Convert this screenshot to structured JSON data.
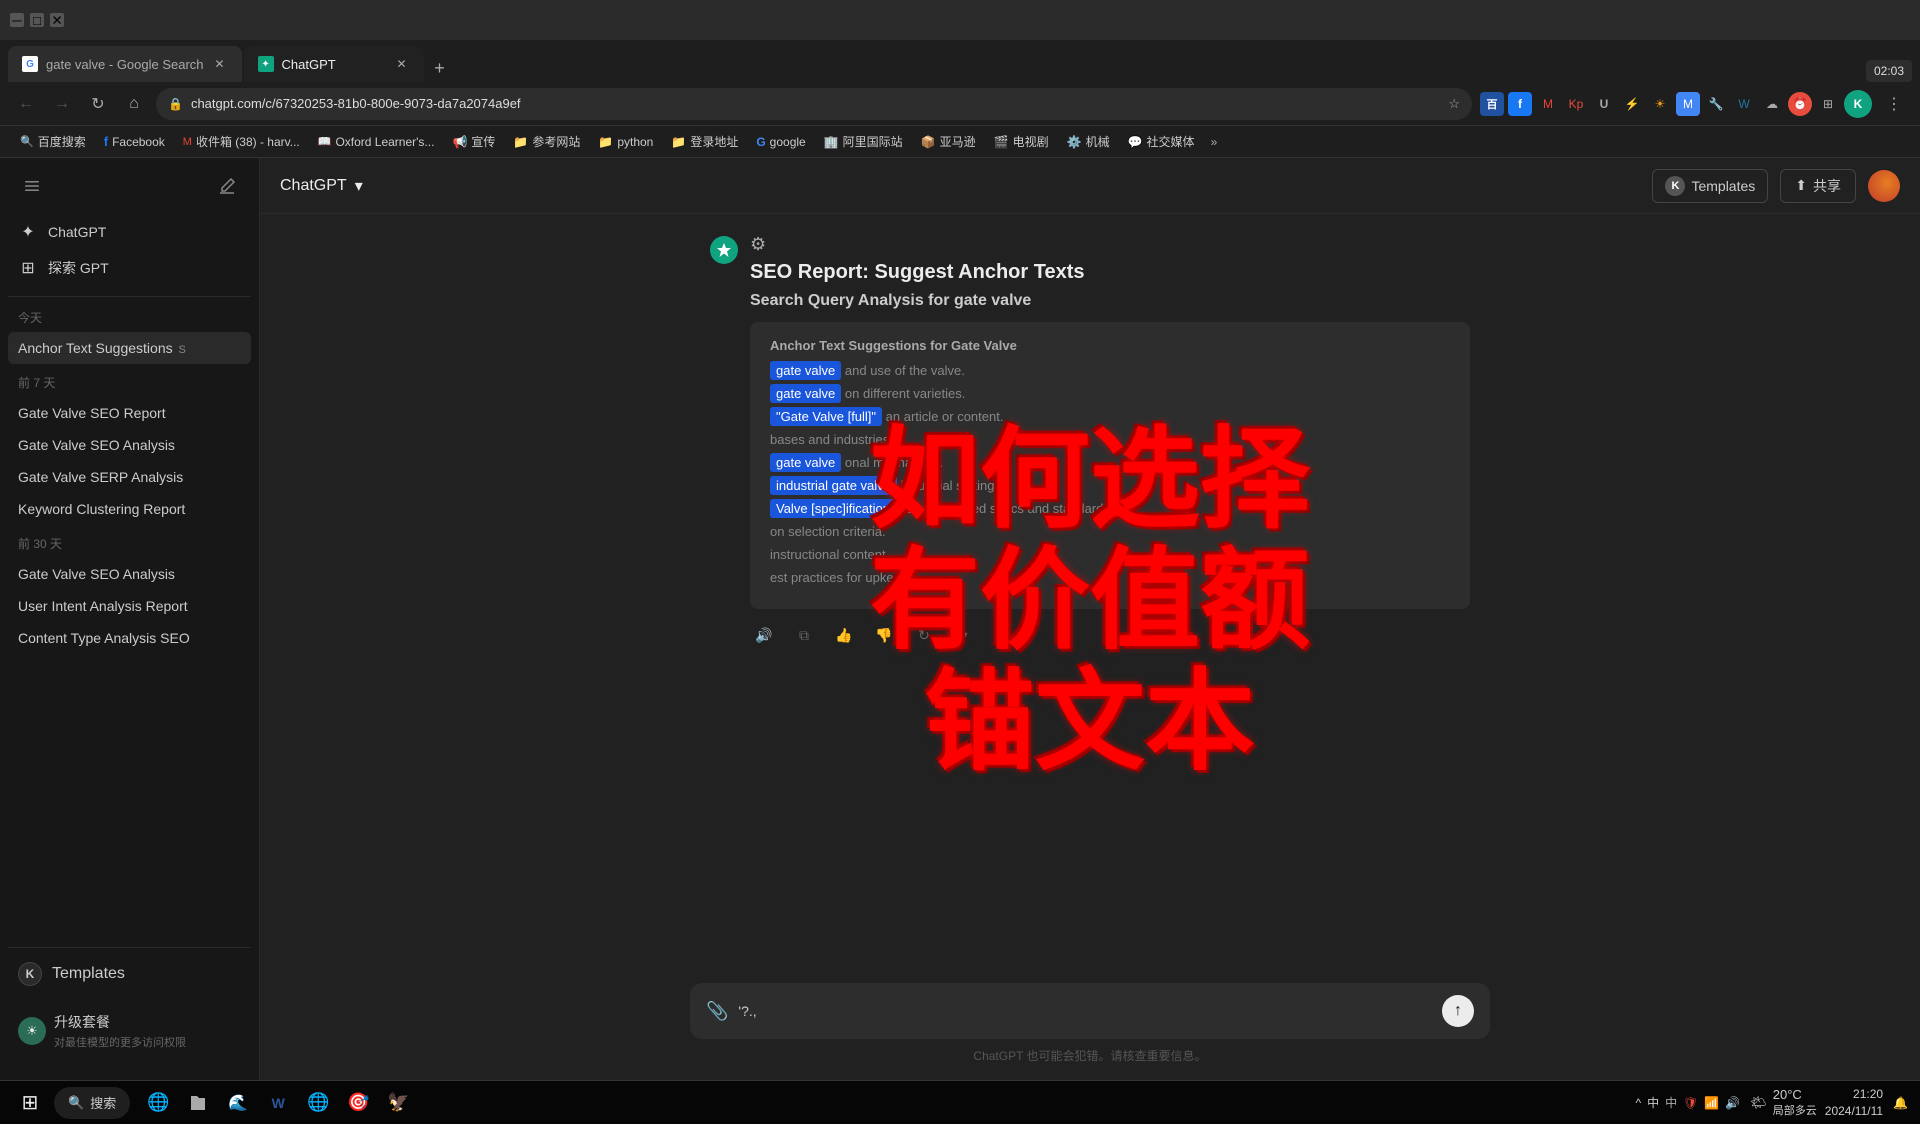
{
  "browser": {
    "tabs": [
      {
        "id": "tab1",
        "title": "gate valve - Google Search",
        "favicon": "G",
        "favicon_bg": "#fff",
        "favicon_color": "#4285f4",
        "active": false
      },
      {
        "id": "tab2",
        "title": "ChatGPT",
        "favicon": "✦",
        "favicon_bg": "#10a37f",
        "favicon_color": "#fff",
        "active": true
      }
    ],
    "new_tab_label": "+",
    "address_url": "chatgpt.com/c/67320253-81b0-800e-9073-da7a2074a9ef",
    "bookmarks": [
      {
        "label": "百度搜索",
        "icon": "🔍"
      },
      {
        "label": "Facebook",
        "icon": "f"
      },
      {
        "label": "收件箱 (38) - harv...",
        "icon": "M"
      },
      {
        "label": "Oxford Learner's...",
        "icon": "📖"
      },
      {
        "label": "宣传",
        "icon": "📢"
      },
      {
        "label": "参考网站",
        "icon": "📁"
      },
      {
        "label": "python",
        "icon": "📁"
      },
      {
        "label": "登录地址",
        "icon": "📁"
      },
      {
        "label": "google",
        "icon": "G"
      },
      {
        "label": "阿里国际站",
        "icon": "🏢"
      },
      {
        "label": "亚马逊",
        "icon": "📦"
      },
      {
        "label": "电视剧",
        "icon": "🎬"
      },
      {
        "label": "机械",
        "icon": "⚙️"
      },
      {
        "label": "社交媒体",
        "icon": "💬"
      }
    ],
    "bookmarks_more": "»",
    "time_badge": "02:03"
  },
  "sidebar": {
    "chatgpt_label": "ChatGPT",
    "explore_gpt_label": "探索 GPT",
    "today_label": "今天",
    "last7_label": "前 7 天",
    "last30_label": "前 30 天",
    "items_today": [
      {
        "id": "anchor-text",
        "label": "Anchor Text Suggestions",
        "badge": "S",
        "has_more": true
      }
    ],
    "items_7days": [
      {
        "id": "gv-seo-report",
        "label": "Gate Valve SEO Report"
      },
      {
        "id": "gv-seo-analysis",
        "label": "Gate Valve SEO Analysis"
      },
      {
        "id": "gv-serp-analysis",
        "label": "Gate Valve SERP Analysis"
      },
      {
        "id": "kw-clustering",
        "label": "Keyword Clustering Report"
      }
    ],
    "items_30days": [
      {
        "id": "gv-seo-analysis2",
        "label": "Gate Valve SEO Analysis"
      },
      {
        "id": "user-intent",
        "label": "User Intent Analysis Report"
      },
      {
        "id": "content-type",
        "label": "Content Type Analysis SEO"
      }
    ],
    "templates_label": "Templates",
    "upgrade_title": "升级套餐",
    "upgrade_subtitle": "对最佳模型的更多访问权限"
  },
  "header": {
    "chatgpt_title": "ChatGPT",
    "dropdown_symbol": "▾",
    "templates_label": "Templates",
    "share_label": "共享",
    "k_icon": "K"
  },
  "chat": {
    "title": "SEO Report: Suggest Anchor Texts",
    "subtitle": "Search Query Analysis for gate valve",
    "gear_icon": "⚙",
    "report_box": {
      "section_title": "Anchor Text Suggestions for Gate Valve",
      "items": [
        {
          "highlight": "gate valve",
          "desc": "and use of the valve."
        },
        {
          "highlight": "gate valve",
          "desc": "on different varieties."
        },
        {
          "highlight": "\"Gate Valve [full]\"",
          "desc": "an article or content."
        },
        {
          "highlight": "",
          "desc": "bases and industries."
        },
        {
          "highlight": "gate valve",
          "desc": "onal mechanism."
        },
        {
          "highlight": "industrial gate valve",
          "desc": "industrial settings."
        },
        {
          "highlight": "Valve [spec]ifications",
          "desc": "cts to detailed specs and standards."
        },
        {
          "highlight": "",
          "desc": "on selection criteria."
        },
        {
          "highlight": "",
          "desc": "instructional content."
        },
        {
          "highlight": "",
          "desc": "est practices for upkeep."
        }
      ]
    },
    "actions": {
      "audio": "🔊",
      "copy": "⧉",
      "thumbup": "👍",
      "thumbdown": "👎",
      "refresh": "↻",
      "expand": "▾"
    }
  },
  "input": {
    "placeholder": "'?.,",
    "attach_icon": "📎",
    "submit_icon": "↑",
    "disclaimer": "ChatGPT 也可能会犯错。请核查重要信息。"
  },
  "watermark": {
    "line1": "如何选择",
    "line2": "有价值额",
    "line3": "锚文本"
  },
  "taskbar": {
    "start_icon": "⊞",
    "search_placeholder": "搜索",
    "search_icon": "🔍",
    "time": "21:20",
    "date": "2024/11/11",
    "weather_icon": "🌤",
    "temp": "20°C",
    "weather_desc": "局部多云",
    "ime_label": "中",
    "icons": [
      "⊞",
      "🔍",
      "🌐",
      "📁",
      "🌍",
      "📝",
      "🎯",
      "🦅"
    ]
  }
}
